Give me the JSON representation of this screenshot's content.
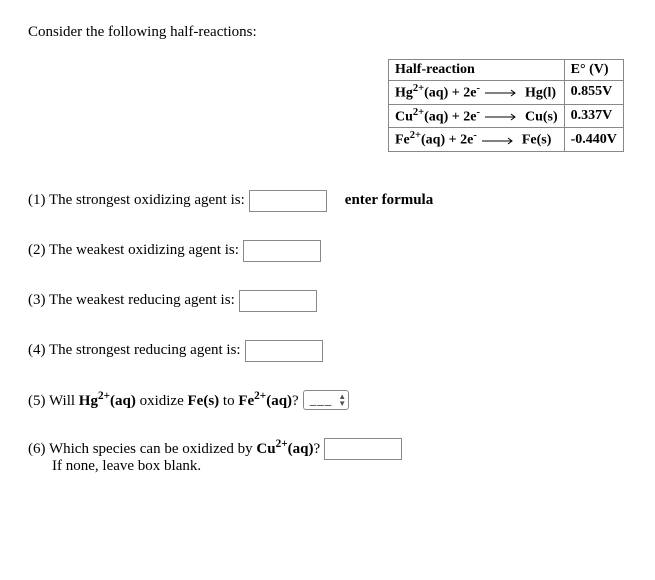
{
  "intro": "Consider the following half-reactions:",
  "table": {
    "headers": {
      "col1": "Half-reaction",
      "col2": "E° (V)"
    },
    "rows": [
      {
        "ion": "Hg",
        "charge": "2+",
        "phase_ion": "(aq)",
        "plus_e": " + 2e",
        "e_super": "-",
        "product": " Hg(l)",
        "potential": "0.855V"
      },
      {
        "ion": "Cu",
        "charge": "2+",
        "phase_ion": "(aq)",
        "plus_e": " + 2e",
        "e_super": "-",
        "product": " Cu(s)",
        "potential": "0.337V"
      },
      {
        "ion": "Fe",
        "charge": "2+",
        "phase_ion": "(aq)",
        "plus_e": " + 2e",
        "e_super": "-",
        "product": " Fe(s)",
        "potential": "-0.440V"
      }
    ]
  },
  "q1": {
    "label": "(1) The strongest oxidizing agent is:",
    "hint": "enter formula"
  },
  "q2": {
    "label": "(2) The weakest oxidizing agent is:"
  },
  "q3": {
    "label": "(3) The weakest reducing agent is:"
  },
  "q4": {
    "label": "(4) The strongest reducing agent is:"
  },
  "q5": {
    "prefix": "(5) Will ",
    "species1_el": "Hg",
    "species1_charge": "2+",
    "species1_phase": "(aq)",
    "mid": " oxidize ",
    "species2": "Fe(s)",
    "mid2": " to ",
    "species3_el": "Fe",
    "species3_charge": "2+",
    "species3_phase": "(aq)",
    "suffix": "?"
  },
  "q6": {
    "prefix": "(6) Which species can be oxidized by ",
    "species_el": "Cu",
    "species_charge": "2+",
    "species_phase": "(aq)",
    "suffix": "?",
    "line2": "If none, leave box blank."
  },
  "select_placeholder": "___"
}
